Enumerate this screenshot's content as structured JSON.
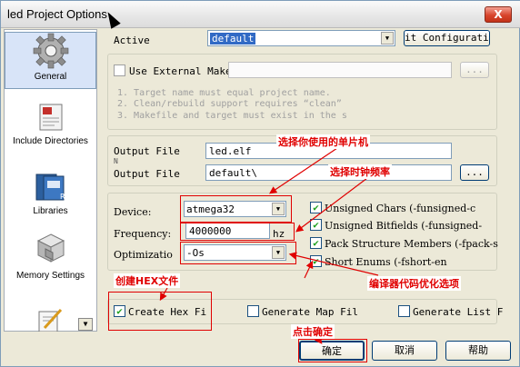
{
  "window": {
    "title": "led Project Options",
    "close_label": "X"
  },
  "sidebar": {
    "items": [
      {
        "label": "General",
        "icon": "gear-icon"
      },
      {
        "label": "Include Directories",
        "icon": "include-directories-icon"
      },
      {
        "label": "Libraries",
        "icon": "libraries-icon"
      },
      {
        "label": "Memory Settings",
        "icon": "memory-settings-icon"
      },
      {
        "label": "",
        "icon": "custom-options-icon"
      }
    ]
  },
  "general": {
    "active_label": "Active",
    "active_value": "default",
    "config_button": "it Configuratio",
    "use_external_makefile": "Use External Makef",
    "browse_label": "...",
    "notes": [
      "1. Target name must equal project name.",
      "2. Clean/rebuild support requires  “clean”",
      "3. Makefile and target must exist in the s"
    ],
    "output_file_label": "Output File",
    "output_file_value": "led.elf",
    "output_file_overlap": "N",
    "output_dir_label": "Output File",
    "output_dir_value": "default\\",
    "device_label": "Device:",
    "device_value": "atmega32",
    "frequency_label": "Frequency:",
    "frequency_value": "4000000",
    "frequency_unit": "hz",
    "optimization_label": "Optimizatio",
    "optimization_value": "-Os",
    "checks": [
      {
        "label": "Unsigned Chars (-funsigned-c",
        "checked": true
      },
      {
        "label": "Unsigned Bitfields (-funsigned-",
        "checked": true
      },
      {
        "label": "Pack Structure Members (-fpack-s",
        "checked": true
      },
      {
        "label": "Short Enums (-fshort-en",
        "checked": true
      }
    ],
    "create_hex_label": "Create Hex Fi",
    "generate_map_label": "Generate Map Fil",
    "generate_list_label": "Generate List F"
  },
  "footer": {
    "ok": "确定",
    "cancel": "取消",
    "help": "帮助"
  },
  "annotations": {
    "select_mcu": "选择你使用的单片机",
    "select_clock": "选择时钟频率",
    "optimization": "编译器代码优化选项",
    "create_hex": "创建HEX文件",
    "click_ok": "点击确定"
  }
}
